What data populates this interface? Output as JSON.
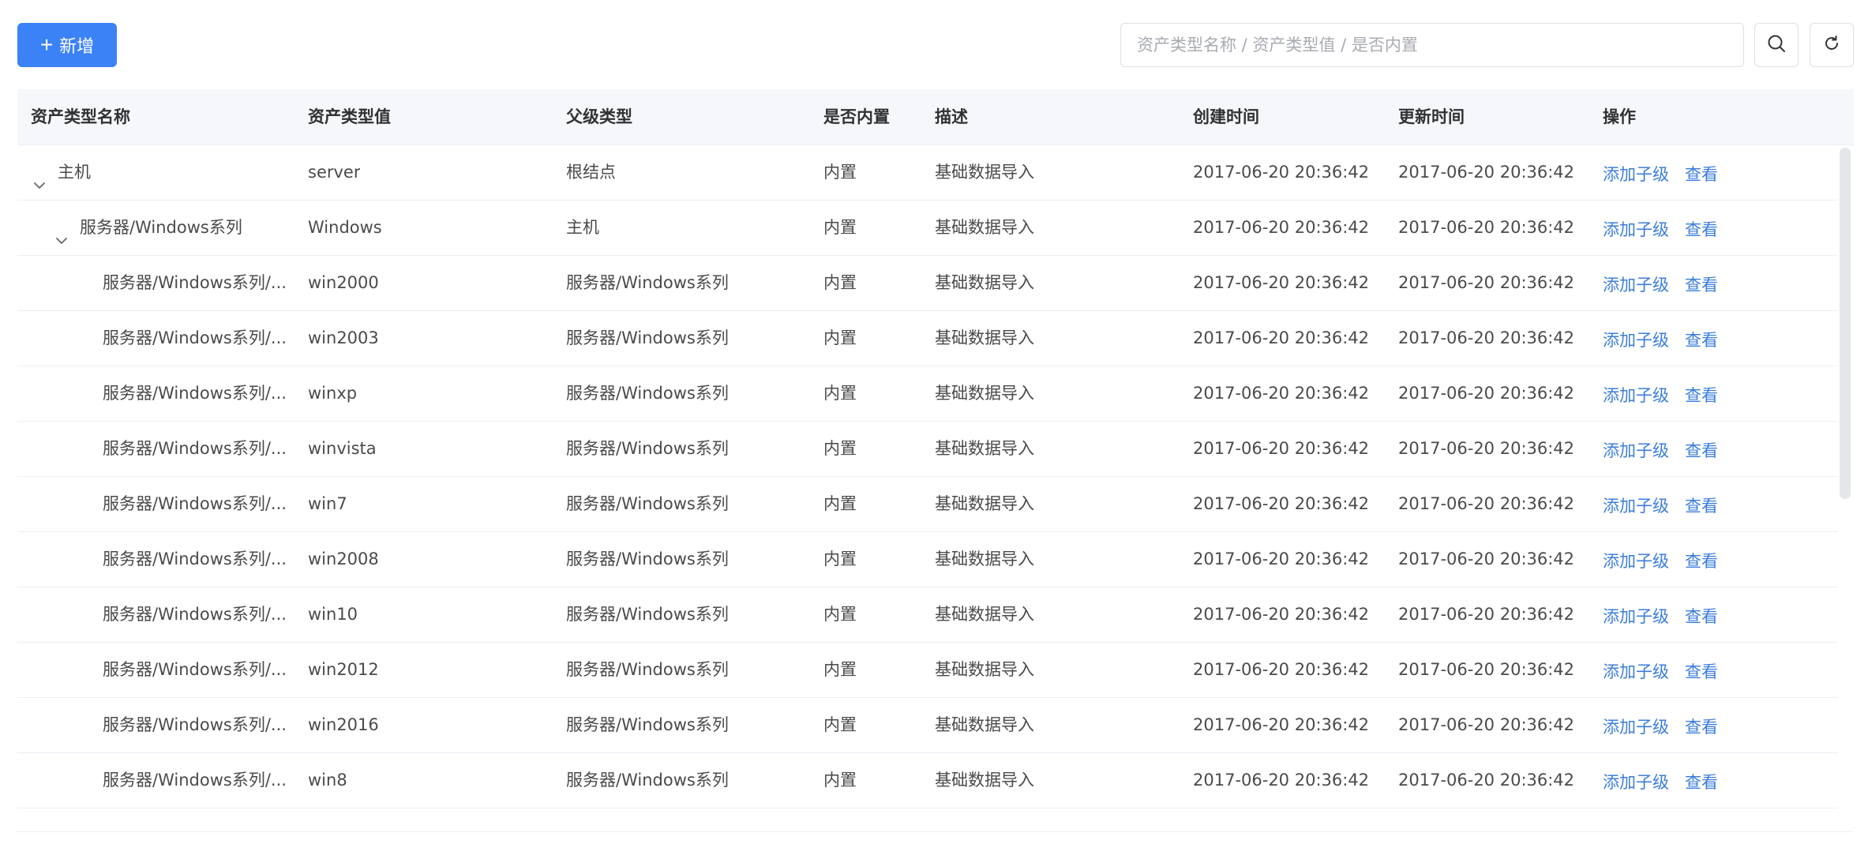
{
  "toolbar": {
    "add_label": "新增",
    "search_placeholder": "资产类型名称 / 资产类型值 / 是否内置"
  },
  "table": {
    "columns": [
      "资产类型名称",
      "资产类型值",
      "父级类型",
      "是否内置",
      "描述",
      "创建时间",
      "更新时间",
      "操作"
    ],
    "actions": {
      "add_child": "添加子级",
      "view": "查看"
    },
    "rows": [
      {
        "name": "主机",
        "value": "server",
        "parent": "根结点",
        "builtin": "内置",
        "desc": "基础数据导入",
        "created": "2017-06-20 20:36:42",
        "updated": "2017-06-20 20:36:42"
      },
      {
        "name": "服务器/Windows系列",
        "value": "Windows",
        "parent": "主机",
        "builtin": "内置",
        "desc": "基础数据导入",
        "created": "2017-06-20 20:36:42",
        "updated": "2017-06-20 20:36:42"
      },
      {
        "name": "服务器/Windows系列/...",
        "value": "win2000",
        "parent": "服务器/Windows系列",
        "builtin": "内置",
        "desc": "基础数据导入",
        "created": "2017-06-20 20:36:42",
        "updated": "2017-06-20 20:36:42"
      },
      {
        "name": "服务器/Windows系列/...",
        "value": "win2003",
        "parent": "服务器/Windows系列",
        "builtin": "内置",
        "desc": "基础数据导入",
        "created": "2017-06-20 20:36:42",
        "updated": "2017-06-20 20:36:42"
      },
      {
        "name": "服务器/Windows系列/...",
        "value": "winxp",
        "parent": "服务器/Windows系列",
        "builtin": "内置",
        "desc": "基础数据导入",
        "created": "2017-06-20 20:36:42",
        "updated": "2017-06-20 20:36:42"
      },
      {
        "name": "服务器/Windows系列/...",
        "value": "winvista",
        "parent": "服务器/Windows系列",
        "builtin": "内置",
        "desc": "基础数据导入",
        "created": "2017-06-20 20:36:42",
        "updated": "2017-06-20 20:36:42"
      },
      {
        "name": "服务器/Windows系列/...",
        "value": "win7",
        "parent": "服务器/Windows系列",
        "builtin": "内置",
        "desc": "基础数据导入",
        "created": "2017-06-20 20:36:42",
        "updated": "2017-06-20 20:36:42"
      },
      {
        "name": "服务器/Windows系列/...",
        "value": "win2008",
        "parent": "服务器/Windows系列",
        "builtin": "内置",
        "desc": "基础数据导入",
        "created": "2017-06-20 20:36:42",
        "updated": "2017-06-20 20:36:42"
      },
      {
        "name": "服务器/Windows系列/...",
        "value": "win10",
        "parent": "服务器/Windows系列",
        "builtin": "内置",
        "desc": "基础数据导入",
        "created": "2017-06-20 20:36:42",
        "updated": "2017-06-20 20:36:42"
      },
      {
        "name": "服务器/Windows系列/...",
        "value": "win2012",
        "parent": "服务器/Windows系列",
        "builtin": "内置",
        "desc": "基础数据导入",
        "created": "2017-06-20 20:36:42",
        "updated": "2017-06-20 20:36:42"
      },
      {
        "name": "服务器/Windows系列/...",
        "value": "win2016",
        "parent": "服务器/Windows系列",
        "builtin": "内置",
        "desc": "基础数据导入",
        "created": "2017-06-20 20:36:42",
        "updated": "2017-06-20 20:36:42"
      },
      {
        "name": "服务器/Windows系列/...",
        "value": "win8",
        "parent": "服务器/Windows系列",
        "builtin": "内置",
        "desc": "基础数据导入",
        "created": "2017-06-20 20:36:42",
        "updated": "2017-06-20 20:36:42"
      }
    ]
  }
}
